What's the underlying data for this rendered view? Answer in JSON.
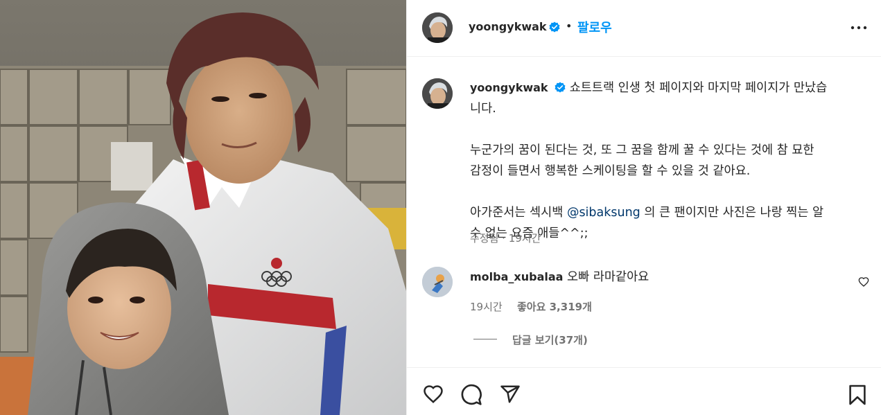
{
  "post": {
    "author": "yoongykwak",
    "follow_label": "팔로우",
    "separator": "•",
    "caption": {
      "user": "yoongykwak",
      "line1a": "쇼트트랙 인생 첫 페이지와 마지막 페이지가 만났습",
      "line1b": "니다.",
      "para2a": "누군가의 꿈이 된다는 것, 또 그 꿈을 함께 꿀 수 있다는 것에 참 묘한",
      "para2b": "감정이 들면서 행복한 스케이팅을 할 수 있을 것 같아요.",
      "para3_pre": "아가준서는 섹시백 ",
      "mention": "@sibaksung",
      "para3_post": " 의 큰 팬이지만 사진은 나랑 찍는 알",
      "para3b": "수 없는 요즘 애들^^;;"
    },
    "caption_meta": "수정됨 · 19시간"
  },
  "comment": {
    "user": "molba_xubalaa",
    "text": "오빠 라마같아요",
    "time": "19시간",
    "likes": "좋아요 3,319개",
    "replies": "답글 보기(37개)"
  },
  "icons": {
    "verified": "verified-badge-icon",
    "more": "more-options-icon",
    "like": "heart-icon",
    "comment": "comment-icon",
    "share": "send-icon",
    "save": "bookmark-icon",
    "comment_like": "heart-small-icon"
  },
  "colors": {
    "accent": "#0095f6",
    "verified": "#0095f6",
    "mention": "#00376b",
    "secondary_text": "#737373",
    "border": "#efefef"
  }
}
